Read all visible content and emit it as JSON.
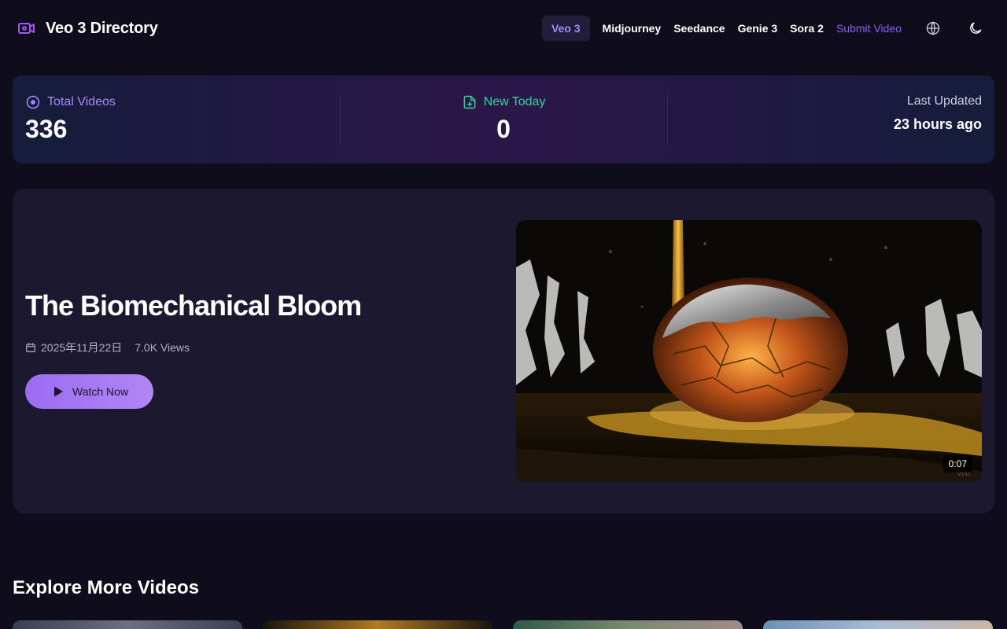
{
  "header": {
    "brand_title": "Veo 3 Directory",
    "nav": [
      {
        "label": "Veo 3",
        "active": true
      },
      {
        "label": "Midjourney"
      },
      {
        "label": "Seedance"
      },
      {
        "label": "Genie 3"
      },
      {
        "label": "Sora 2"
      },
      {
        "label": "Submit Video"
      }
    ],
    "icons": [
      "globe-icon",
      "moon-icon"
    ]
  },
  "stats": {
    "total": {
      "label": "Total Videos",
      "value": "336"
    },
    "new_today": {
      "label": "New Today",
      "value": "0"
    },
    "last_updated": {
      "label": "Last Updated",
      "value": "23 hours ago"
    }
  },
  "featured": {
    "title": "The Biomechanical Bloom",
    "date": "2025年11月22日",
    "views": "7.0K Views",
    "watch_label": "Watch Now",
    "duration": "0:07"
  },
  "explore": {
    "title": "Explore More Videos"
  },
  "colors": {
    "background": "#0f0d1c",
    "accent": "#a78bfa",
    "green": "#34d399",
    "card": "#1c1830"
  }
}
